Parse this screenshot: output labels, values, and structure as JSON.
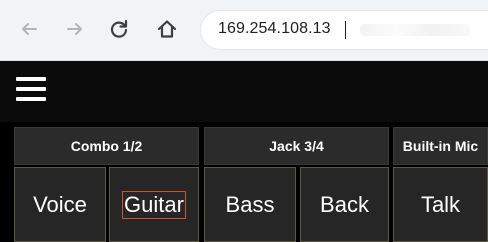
{
  "browser": {
    "url": "169.254.108.13",
    "back_icon": "arrow-left-icon",
    "forward_icon": "arrow-right-icon",
    "reload_icon": "reload-icon",
    "home_icon": "home-icon"
  },
  "app": {
    "menu_icon": "hamburger-menu-icon",
    "groups": [
      {
        "label": "Combo 1/2",
        "buttons": [
          "Voice",
          "Guitar"
        ]
      },
      {
        "label": "Jack 3/4",
        "buttons": [
          "Bass",
          "Back"
        ]
      },
      {
        "label": "Built-in Mic",
        "buttons": [
          "Talk"
        ]
      }
    ],
    "selected_button": "Guitar",
    "colors": {
      "background": "#000000",
      "button": "#262626",
      "selected_outline": "#d0522c"
    }
  }
}
